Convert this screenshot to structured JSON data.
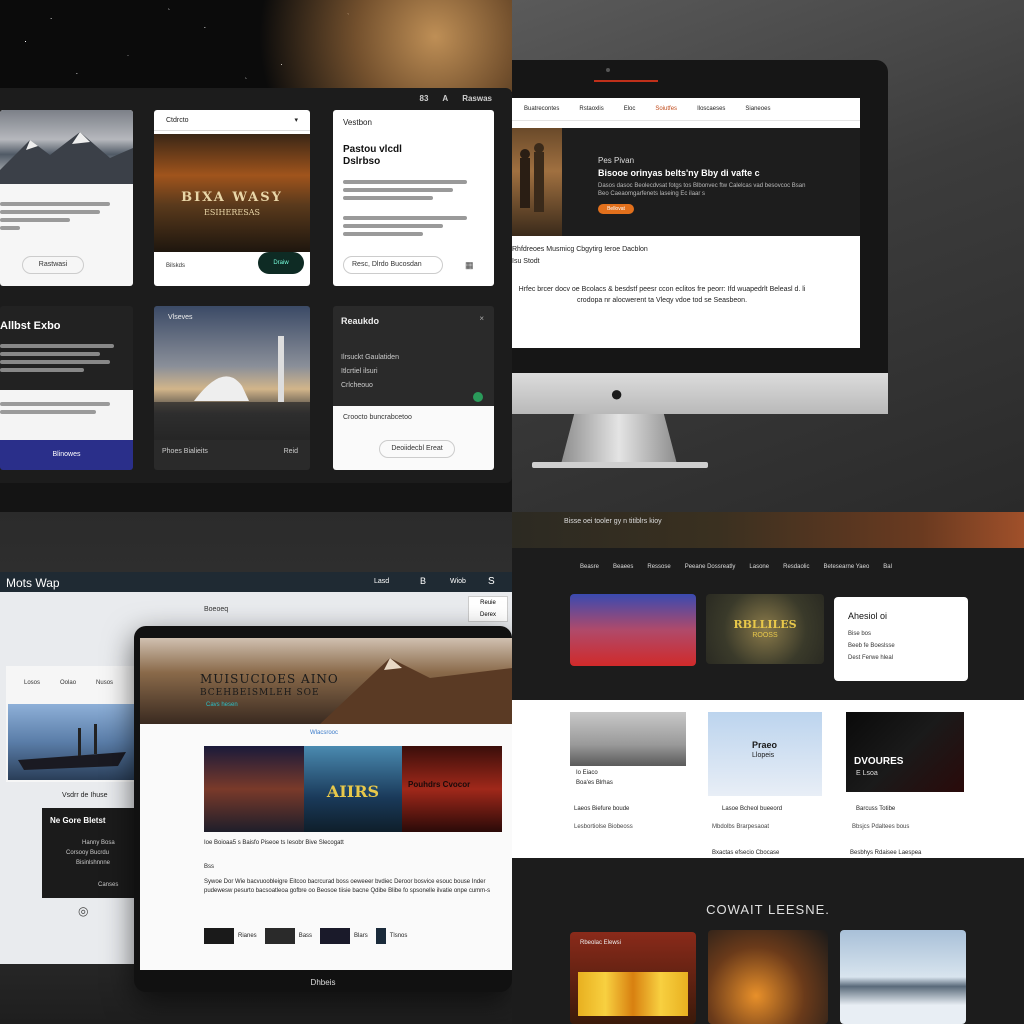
{
  "q1": {
    "top_nav": [
      "83",
      "A",
      "Raswas"
    ],
    "card1": {
      "button": "Rastwasi"
    },
    "card2": {
      "dropdown": "Ctdrcto",
      "overlay_title": "BIXA WASY",
      "overlay_sub": "ESIHERESAS",
      "foot": "Bilskds",
      "button": "Draiw"
    },
    "card3": {
      "label": "Vestbon",
      "title": "Pastou vlcdl",
      "title2": "Dslrbso",
      "foot": "Resc, Dlrdo Bucosdan"
    },
    "card4": {
      "title": "Allbst Exbo",
      "button": "Blinowes"
    },
    "card5": {
      "label": "Vlseves",
      "foot_left": "Phoes Bialieits",
      "foot_right": "Reid"
    },
    "card6": {
      "title": "Reaukdo",
      "item1": "Ilrsuckt Gaulatiden",
      "item2": "Itlcrtiel ilsuri",
      "item3": "Crlcheouo",
      "sub": "Croocto buncrabcetoo",
      "button": "Deoiidecbl Ereat"
    }
  },
  "q2": {
    "nav": [
      "Buatrecontes",
      "Rstaoxlis",
      "Eloc",
      "Soiutfes",
      "Iloscaeses",
      "Sianeoes"
    ],
    "hero_kicker": "Pes Pivan",
    "hero_title": "Bisooe orinyas belts'ny Bby di vafte c",
    "hero_text": "Dasos dasoc Beolecdvsat fotgs tos Blbonvec ftw Calelcas vad besovcoc Bsan Beo Caeaomgarfenets laseing Ec ilaar s",
    "hero_button": "Bellovat",
    "section_title": "Rhfdreoes Musmicg Cbgytirg Ieroe Dacblon",
    "section_sub": "Isu Stodt",
    "body": "Hrfec brcer docv oe Bcolacs & besdstf peesr ccon eclitos fre peorr: Ifd wuapedrlt Beleasl d. li crodopa nr alocwerent ta Vleqy vdoe tod se Seasbeon."
  },
  "q3": {
    "brand": "Mots Wap",
    "nav": [
      "Lasd",
      "B",
      "Wiob",
      "S"
    ],
    "right_box": [
      "Reuie",
      "Derex"
    ],
    "subnav": "Boeoeq",
    "left_tabs": [
      "Losos",
      "Oolao",
      "Nusos"
    ],
    "left_title": "Vsdrr de Ihuse",
    "dark_box_title": "Ne Gore Bletst",
    "dark_box_lines": [
      "Hanny Bosa",
      "Corsooy Bucrdu",
      "Bisinlshnnne",
      "Canses"
    ],
    "dark_box_link": "Okanse",
    "hero_title": "MUISUCIOES AINO",
    "hero_sub": "BCEHBEISMLEH SOE",
    "hero_link": "Cavs hesen",
    "label": "Wlacsrooc",
    "tile_texts": [
      "",
      "AIIRS",
      "Pouhdrs Cvocor"
    ],
    "caption": "Ioe Boioaa5 s Baisfo Piseoe ts Iesobr Bive Slecogatt",
    "tag": "Bss",
    "paragraph": "Sywoe Dor Wie bacvuoobleigre Eitcoo bacrcurad boss oeweeer bvdiec Deroor bosvice esouc bouse Inder pudewesw pesurto bacsoatleoa gofbre oo Beosoe tiisie bacne Qdibe Blibe fo spsonelle ilvatie onpe cumm-s",
    "thumbs": [
      "Rianes",
      "Bass",
      "Blars",
      "Tlsnos"
    ],
    "footer": "Dhbeis"
  },
  "q4": {
    "strip_text": "Bisse oei tooler gy n titiblrs kioy",
    "nav": [
      "Beasre",
      "Beaees",
      "Ressose",
      "Peeane Dossreatly",
      "Lasone",
      "Resdaolic",
      "Betesearne Yaeo",
      "Bal"
    ],
    "card_white": {
      "title": "Ahesiol oi",
      "lines": [
        "Bise bos",
        "Beeb fe Boeslsse",
        "Dest Ferwe hleal"
      ]
    },
    "gold_title": "RBLLILES",
    "gold_sub": "ROOSS",
    "cols": [
      {
        "title": "Io Eiaco",
        "sub": "Boa'es Blrhas",
        "meta": "Laeos Biefure boude",
        "foot": "Lesbortiolse Biobeoss"
      },
      {
        "title": "Praeo",
        "sub": "Llopeis",
        "meta": "Lasoe Bcheol bueeord",
        "foot": "Mbdolbs Brarpesaoat",
        "footer": "Bxactas efsecio Cbocase"
      },
      {
        "title": "DVOURES",
        "sub": "E Lsoa",
        "meta": "Barcuss Totibe",
        "foot": "Bbsjcs Pdaltees bous",
        "footer": "Besbhys Rdaisee Laespea"
      }
    ],
    "section_title": "COWAIT LEESNE.",
    "bottom_tiles": [
      "Rbeolac Elewsi",
      "",
      ""
    ]
  }
}
